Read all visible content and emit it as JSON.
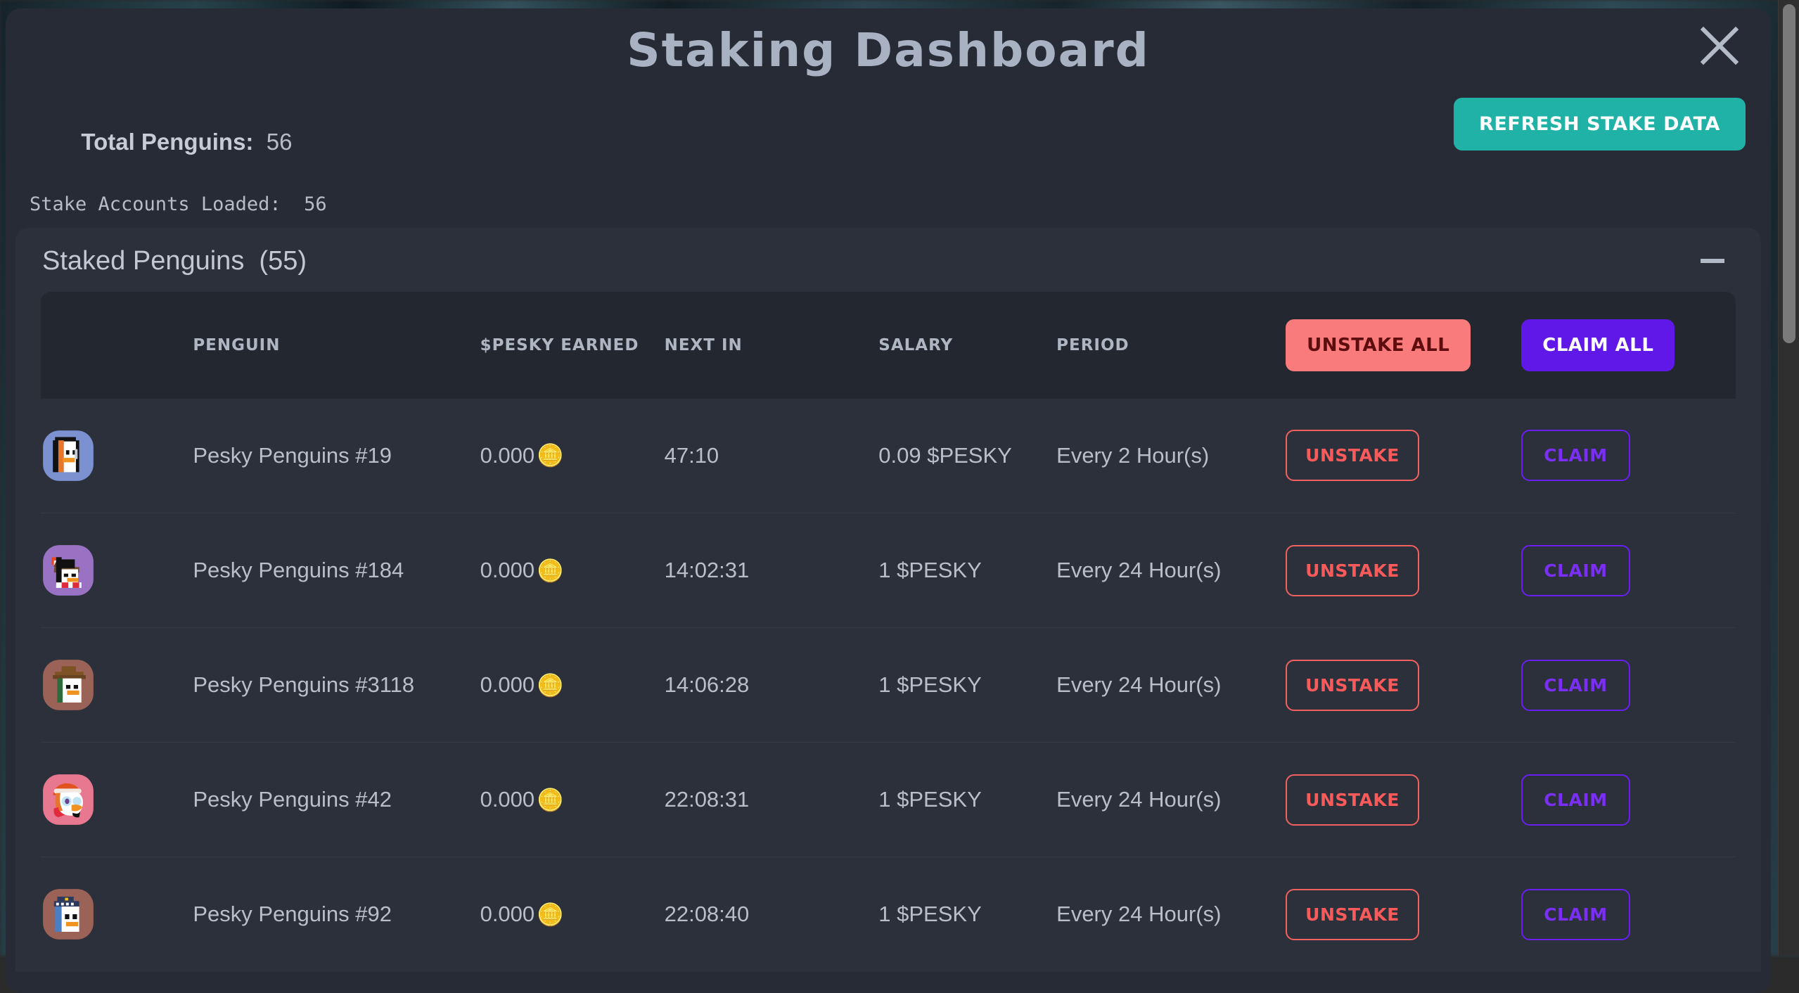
{
  "modal": {
    "title": "Staking Dashboard",
    "close_icon": "close-icon"
  },
  "stats": {
    "total_label": "Total Penguins:",
    "total_value": "56",
    "accounts_line": "Stake Accounts Loaded:  56",
    "refresh_label": "REFRESH STAKE DATA"
  },
  "card": {
    "title": "Staked Penguins  (55)",
    "collapse_icon": "minus-icon"
  },
  "table": {
    "headers": {
      "penguin": "PENGUIN",
      "earned": "$PESKY EARNED",
      "next": "NEXT IN",
      "salary": "SALARY",
      "period": "PERIOD"
    },
    "unstake_all_label": "UNSTAKE ALL",
    "claim_all_label": "CLAIM ALL",
    "row_unstake_label": "UNSTAKE",
    "row_claim_label": "CLAIM",
    "coin_icon": "coin-icon",
    "rows": [
      {
        "avatar": "penguin-avatar-blue",
        "name": "Pesky Penguins #19",
        "earned": "0.000",
        "next_in": "47:10",
        "salary": "0.09 $PESKY",
        "period": "Every 2 Hour(s)"
      },
      {
        "avatar": "penguin-avatar-purple",
        "name": "Pesky Penguins #184",
        "earned": "0.000",
        "next_in": "14:02:31",
        "salary": "1 $PESKY",
        "period": "Every 24 Hour(s)"
      },
      {
        "avatar": "penguin-avatar-brown",
        "name": "Pesky Penguins #3118",
        "earned": "0.000",
        "next_in": "14:06:28",
        "salary": "1 $PESKY",
        "period": "Every 24 Hour(s)"
      },
      {
        "avatar": "penguin-avatar-pink",
        "name": "Pesky Penguins #42",
        "earned": "0.000",
        "next_in": "22:08:31",
        "salary": "1 $PESKY",
        "period": "Every 24 Hour(s)"
      },
      {
        "avatar": "penguin-avatar-rose",
        "name": "Pesky Penguins #92",
        "earned": "0.000",
        "next_in": "22:08:40",
        "salary": "1 $PESKY",
        "period": "Every 24 Hour(s)"
      }
    ]
  },
  "colors": {
    "modal_bg": "#272b35",
    "card_bg": "#2b303b",
    "table_head_bg": "#23272f",
    "accent_teal": "#20b2a6",
    "accent_purple": "#6018e8",
    "accent_red": "#fa7b7b",
    "text": "#b8bfcb"
  }
}
